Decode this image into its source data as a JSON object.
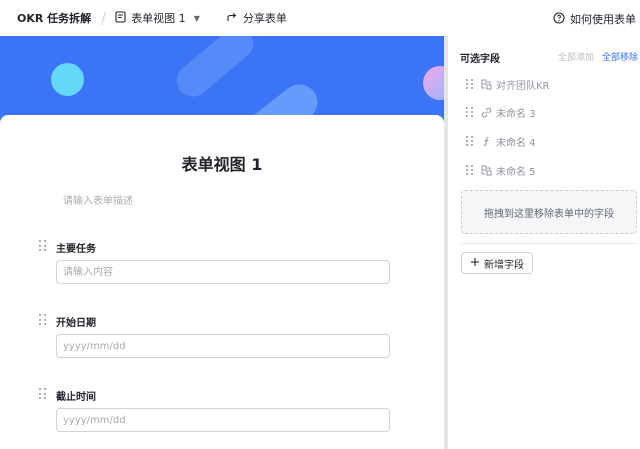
{
  "topbar": {
    "app_title": "OKR 任务拆解",
    "view_name": "表单视图 1",
    "share_label": "分享表单",
    "help_label": "如何使用表单"
  },
  "form": {
    "title": "表单视图 1",
    "description_placeholder": "请输入表单描述",
    "fields": [
      {
        "label": "主要任务",
        "placeholder": "请输入内容"
      },
      {
        "label": "开始日期",
        "placeholder": "yyyy/mm/dd"
      },
      {
        "label": "截止时间",
        "placeholder": "yyyy/mm/dd"
      }
    ]
  },
  "sidebar": {
    "title": "可选字段",
    "add_all": "全部添加",
    "remove_all": "全部移除",
    "items": [
      {
        "label": "对齐团队KR",
        "icon": "lookup-icon"
      },
      {
        "label": "未命名 3",
        "icon": "link-icon"
      },
      {
        "label": "未命名 4",
        "icon": "formula-icon"
      },
      {
        "label": "未命名 5",
        "icon": "lookup-icon"
      }
    ],
    "drop_hint": "拖拽到这里移除表单中的字段",
    "new_field_label": "新增字段"
  },
  "colors": {
    "banner": "#3b75f6",
    "accent": "#3370ff"
  }
}
